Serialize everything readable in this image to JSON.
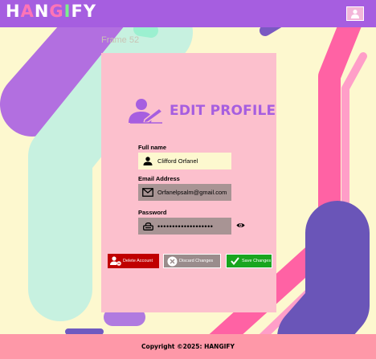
{
  "header": {
    "logo_letters": [
      {
        "char": "H",
        "color": "#ffffff"
      },
      {
        "char": "A",
        "color": "#ff74b6"
      },
      {
        "char": "N",
        "color": "#ffffff"
      },
      {
        "char": "G",
        "color": "#ff74b6"
      },
      {
        "char": "I",
        "color": "#7cf08b"
      },
      {
        "char": "F",
        "color": "#ffffff"
      },
      {
        "char": "Y",
        "color": "#ffffff"
      }
    ],
    "avatar_icon": "user-icon"
  },
  "frame_label": "Frame 52",
  "profile": {
    "title": "EDIT PROFILE",
    "title_icon": "user-edit-icon",
    "full_name_label": "Full name",
    "full_name_value": "Clifford Orfanel",
    "email_label": "Email Address",
    "email_value": "Orfanelpsalm@gmail.com",
    "password_label": "Password",
    "password_value": "•••••••••••••••••••"
  },
  "buttons": {
    "delete": "Delete Account",
    "discard": "Discard Changes",
    "save": "Save Changes"
  },
  "footer": {
    "copyright": "Copyright ©2025: HANGIFY"
  },
  "colors": {
    "accent": "#a65ee0",
    "background": "#fdf8cf",
    "card": "#fcc0cd",
    "footer": "#fe98a8",
    "delete": "#c00000",
    "save": "#19a51f"
  }
}
